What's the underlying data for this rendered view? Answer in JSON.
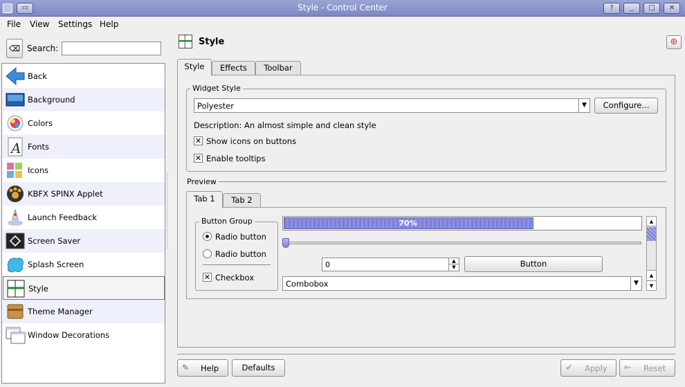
{
  "window": {
    "title": "Style - Control Center"
  },
  "menubar": {
    "file": "File",
    "view": "View",
    "settings": "Settings",
    "help": "Help"
  },
  "search": {
    "label": "Search:",
    "value": ""
  },
  "sidebar": {
    "items": [
      {
        "label": "Back",
        "icon": "back-arrow-icon"
      },
      {
        "label": "Background",
        "icon": "background-icon"
      },
      {
        "label": "Colors",
        "icon": "colors-icon"
      },
      {
        "label": "Fonts",
        "icon": "fonts-icon"
      },
      {
        "label": "Icons",
        "icon": "icons-icon"
      },
      {
        "label": "KBFX SPINX Applet",
        "icon": "kbfx-icon"
      },
      {
        "label": "Launch Feedback",
        "icon": "launch-feedback-icon"
      },
      {
        "label": "Screen Saver",
        "icon": "screen-saver-icon"
      },
      {
        "label": "Splash Screen",
        "icon": "splash-screen-icon"
      },
      {
        "label": "Style",
        "icon": "style-icon",
        "selected": true
      },
      {
        "label": "Theme Manager",
        "icon": "theme-manager-icon"
      },
      {
        "label": "Window Decorations",
        "icon": "window-decorations-icon"
      }
    ]
  },
  "header": {
    "title": "Style"
  },
  "tabs": [
    {
      "label": "Style",
      "active": true
    },
    {
      "label": "Effects"
    },
    {
      "label": "Toolbar"
    }
  ],
  "widget_style": {
    "group_label": "Widget Style",
    "selected": "Polyester",
    "configure_label": "Configure...",
    "description": "Description: An almost simple and clean style",
    "show_icons_label": "Show icons on buttons",
    "show_icons_checked": true,
    "tooltips_label": "Enable tooltips",
    "tooltips_checked": true
  },
  "preview": {
    "label": "Preview",
    "tabs": [
      {
        "label": "Tab 1",
        "active": true
      },
      {
        "label": "Tab 2"
      }
    ],
    "button_group_label": "Button Group",
    "radio1_label": "Radio button",
    "radio2_label": "Radio button",
    "checkbox_label": "Checkbox",
    "progress_text": "70%",
    "progress_value": 0.7,
    "spin_value": "0",
    "button_label": "Button",
    "combobox_value": "Combobox"
  },
  "bottom": {
    "help": "Help",
    "defaults": "Defaults",
    "apply": "Apply",
    "reset": "Reset"
  },
  "colors": {
    "titlebar": "#8a94cc",
    "progress": "#7c80d8",
    "selection": "#eef1fb"
  }
}
